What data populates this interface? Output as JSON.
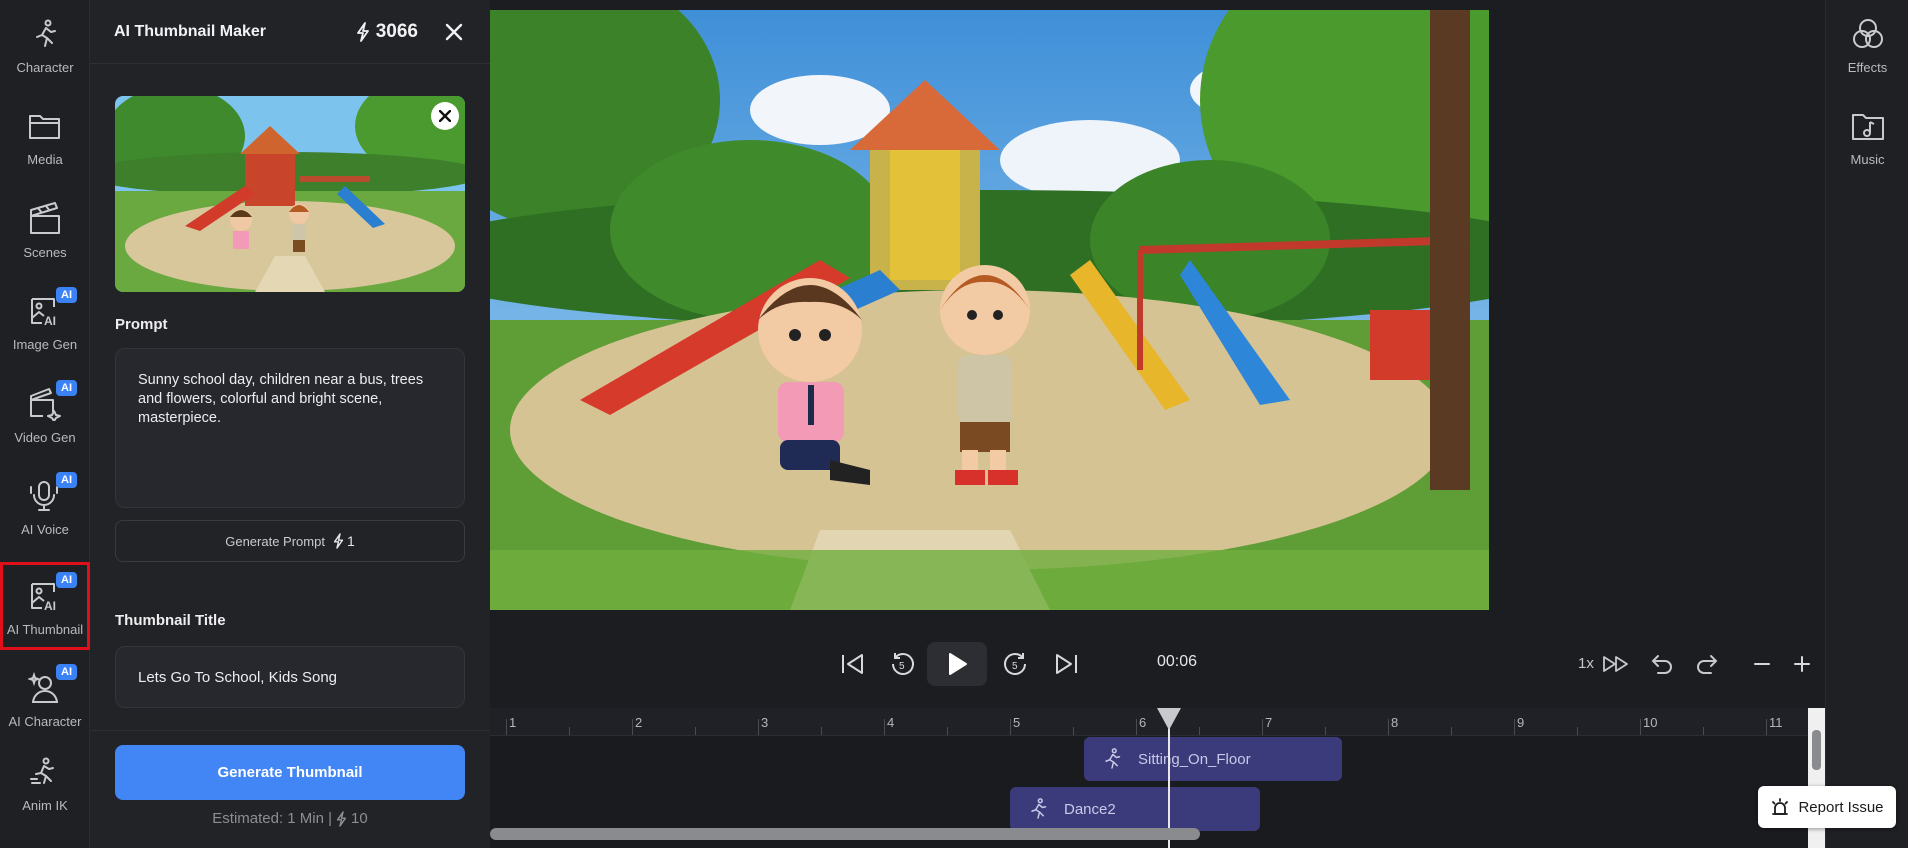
{
  "left_rail": {
    "items": [
      {
        "label": "Character",
        "icon": "running-figure-icon",
        "ai": false
      },
      {
        "label": "Media",
        "icon": "folder-icon",
        "ai": false
      },
      {
        "label": "Scenes",
        "icon": "clapperboard-icon",
        "ai": false
      },
      {
        "label": "Image Gen",
        "icon": "image-ai-icon",
        "ai": true
      },
      {
        "label": "Video Gen",
        "icon": "video-ai-icon",
        "ai": true
      },
      {
        "label": "AI Voice",
        "icon": "microphone-icon",
        "ai": true
      },
      {
        "label": "AI Thumbnail",
        "icon": "thumbnail-ai-icon",
        "ai": true,
        "selected": true
      },
      {
        "label": "AI Character",
        "icon": "person-sparkle-icon",
        "ai": true
      },
      {
        "label": "Anim IK",
        "icon": "anim-ik-icon",
        "ai": false
      }
    ],
    "ai_badge": "AI"
  },
  "panel": {
    "title": "AI Thumbnail Maker",
    "credits": "3066",
    "prompt_label": "Prompt",
    "prompt_text": "Sunny school day, children near a bus, trees and flowers, colorful and bright scene, masterpiece.",
    "generate_prompt_label": "Generate Prompt",
    "generate_prompt_cost": "1",
    "thumbnail_title_label": "Thumbnail Title",
    "thumbnail_title_value": "Lets Go To School, Kids Song",
    "generate_thumbnail_label": "Generate Thumbnail",
    "estimate_text": "Estimated: 1 Min |",
    "estimate_cost": "10"
  },
  "player": {
    "timecode": "00:06",
    "speed": "1x"
  },
  "timeline": {
    "ticks": [
      "1",
      "2",
      "3",
      "4",
      "5",
      "6",
      "7",
      "8",
      "9",
      "10",
      "11"
    ],
    "clips": [
      {
        "label": "Sitting_On_Floor"
      },
      {
        "label": "Dance2"
      }
    ]
  },
  "right_rail": {
    "items": [
      {
        "label": "Effects",
        "icon": "effects-circles-icon"
      },
      {
        "label": "Music",
        "icon": "music-folder-icon"
      }
    ]
  },
  "report_issue_label": "Report Issue",
  "colors": {
    "accent": "#4285f4",
    "ai_badge": "#3b82f6",
    "selection_outline": "#e0101a",
    "clip": "#3b3a7a"
  }
}
